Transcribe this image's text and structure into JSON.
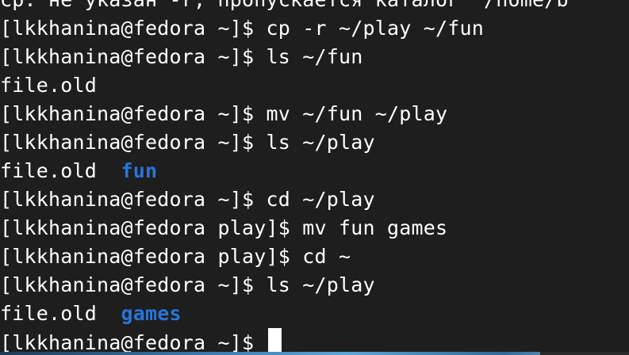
{
  "terminal": {
    "lines": [
      {
        "text": "cp: не указан -r; пропускается каталог '/home/b"
      },
      {
        "text": "[lkkhanina@fedora ~]$ cp -r ~/play ~/fun"
      },
      {
        "text": "[lkkhanina@fedora ~]$ ls ~/fun"
      },
      {
        "text": "file.old"
      },
      {
        "text": "[lkkhanina@fedora ~]$ mv ~/fun ~/play"
      },
      {
        "text": "[lkkhanina@fedora ~]$ ls ~/play"
      },
      {
        "text": "file.old  ",
        "dir": "fun"
      },
      {
        "text": "[lkkhanina@fedora ~]$ cd ~/play"
      },
      {
        "text": "[lkkhanina@fedora play]$ mv fun games"
      },
      {
        "text": "[lkkhanina@fedora play]$ cd ~"
      },
      {
        "text": "[lkkhanina@fedora ~]$ ls ~/play"
      },
      {
        "text": "file.old  ",
        "dir": "games"
      },
      {
        "text": "[lkkhanina@fedora ~]$ ",
        "cursor": true
      }
    ]
  },
  "colors": {
    "background": "#1e1e1e",
    "text": "#ffffff",
    "directory": "#2a74d8"
  }
}
